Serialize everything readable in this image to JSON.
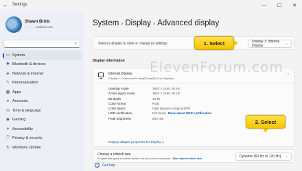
{
  "window": {
    "app_title": "Settings",
    "controls": {
      "minimize": "—",
      "maximize": "☐",
      "close": "✕"
    }
  },
  "profile": {
    "name": "Shawn Brink",
    "email": "···········outlook.com"
  },
  "sidebar": {
    "search_placeholder": "",
    "items": [
      {
        "label": "System",
        "icon": "monitor-icon",
        "glyph": "▭",
        "color": "#0067c0",
        "active": true
      },
      {
        "label": "Bluetooth & devices",
        "icon": "bluetooth-icon",
        "glyph": "✱",
        "color": "#0067c0"
      },
      {
        "label": "Network & internet",
        "icon": "network-icon",
        "glyph": "◈",
        "color": "#2b6cb0"
      },
      {
        "label": "Personalization",
        "icon": "brush-icon",
        "glyph": "✎",
        "color": "#c05a1c"
      },
      {
        "label": "Apps",
        "icon": "apps-icon",
        "glyph": "▦",
        "color": "#4a5a6a"
      },
      {
        "label": "Accounts",
        "icon": "account-icon",
        "glyph": "●",
        "color": "#2e8b57"
      },
      {
        "label": "Time & language",
        "icon": "globe-clock-icon",
        "glyph": "◷",
        "color": "#2b6cb0"
      },
      {
        "label": "Gaming",
        "icon": "controller-icon",
        "glyph": "◉",
        "color": "#555555"
      },
      {
        "label": "Accessibility",
        "icon": "accessibility-icon",
        "glyph": "✦",
        "color": "#1e6fd0"
      },
      {
        "label": "Privacy & security",
        "icon": "shield-icon",
        "glyph": "⛉",
        "color": "#555555"
      },
      {
        "label": "Windows Update",
        "icon": "update-icon",
        "glyph": "↻",
        "color": "#0067c0"
      }
    ]
  },
  "breadcrumb": {
    "parts": [
      "System",
      "Display",
      "Advanced display"
    ],
    "separator": "›"
  },
  "select_display": {
    "label": "Select a display to view or change its settings",
    "value": "Display 1: Internal Display"
  },
  "display_info": {
    "section_title": "Display information",
    "display_name": "Internal Display",
    "display_subtitle": "Display 1: Connected to Intel(R) Iris(R) Plus Graphics",
    "specs": [
      {
        "label": "Desktop mode",
        "value": "3840 × 2160, 60 Hz"
      },
      {
        "label": "Active signal mode",
        "value": "3840 × 2160, 60 Hz"
      },
      {
        "label": "Bit depth",
        "value": "10-bit"
      },
      {
        "label": "Color format",
        "value": "RGB"
      },
      {
        "label": "Color space",
        "value": "High dynamic range (HDR)"
      },
      {
        "label": "HDR certification",
        "value": "Not found",
        "link": "More about HDR certification"
      },
      {
        "label": "Peak brightness",
        "value": "604 nits"
      }
    ],
    "adapter_link": "Display adapter properties for Display 1"
  },
  "refresh_rate": {
    "title": "Choose a refresh rate",
    "subtitle": "A higher rate gives smoother motion, but also uses more power",
    "link": "More about refresh rate",
    "value": "Dynamic (60 Hz or 120 Hz)"
  },
  "help": {
    "label": "Get help"
  },
  "annotations": {
    "callout1": "1. Select",
    "callout2": "2. Select",
    "watermark": "ElevenForum.com"
  },
  "colors": {
    "accent": "#0067c0",
    "link": "#0b5cad",
    "callout": "#f6c400"
  }
}
